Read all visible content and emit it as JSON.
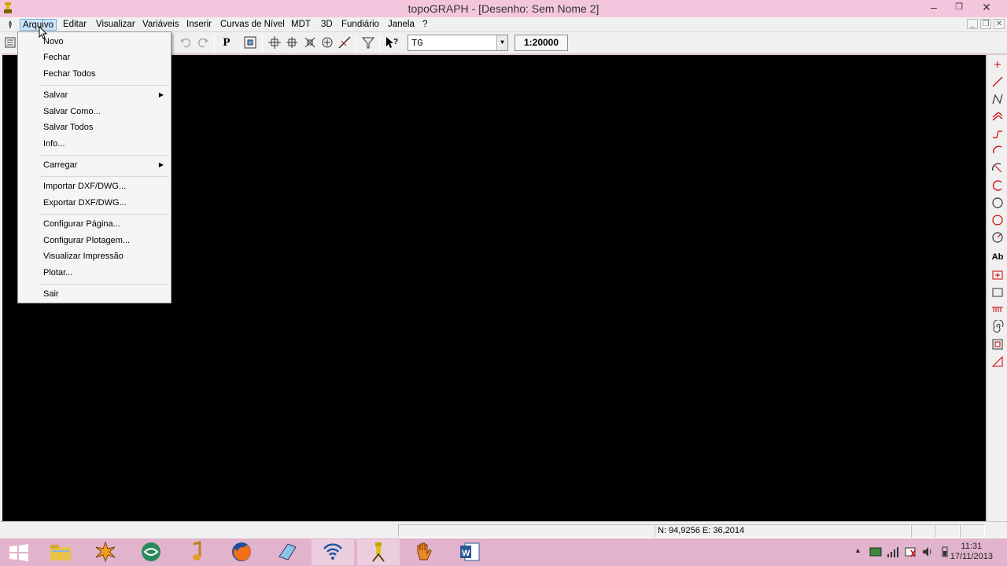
{
  "window": {
    "title": "topoGRAPH - [Desenho: Sem Nome 2]",
    "minimize_icon": "minimize-icon",
    "maximize_icon": "restore-icon",
    "close_icon": "close-icon"
  },
  "menubar": {
    "items": [
      "Arquivo",
      "Editar",
      "Visualizar",
      "Variáveis",
      "Inserir",
      "Curvas de Nível",
      "MDT",
      "3D",
      "Fundiário",
      "Janela",
      "?"
    ],
    "active": "Arquivo"
  },
  "file_menu": {
    "items": [
      {
        "label": "Novo",
        "submenu": false
      },
      {
        "label": "Fechar",
        "submenu": false
      },
      {
        "label": "Fechar Todos",
        "submenu": false
      },
      {
        "label": "Salvar",
        "submenu": true
      },
      {
        "label": "Salvar Como...",
        "submenu": false
      },
      {
        "label": "Salvar Todos",
        "submenu": false
      },
      {
        "label": "Info...",
        "submenu": false
      },
      {
        "label": "Carregar",
        "submenu": true
      },
      {
        "label": "Importar DXF/DWG...",
        "submenu": false
      },
      {
        "label": "Exportar DXF/DWG...",
        "submenu": false
      },
      {
        "label": "Configurar Página...",
        "submenu": false
      },
      {
        "label": "Configurar Plotagem...",
        "submenu": false
      },
      {
        "label": "Visualizar Impressão",
        "submenu": false
      },
      {
        "label": "Plotar...",
        "submenu": false
      },
      {
        "label": "Sair",
        "submenu": false
      }
    ]
  },
  "toolbar": {
    "layer_value": "TG",
    "scale_value": "1:20000",
    "p_label": "P"
  },
  "righttools": {
    "text_tool_label": "Ab"
  },
  "statusbar": {
    "coords": "N: 94,9256 E: 36,2014"
  },
  "taskbar": {
    "time": "11:31",
    "date": "17/11/2013"
  }
}
